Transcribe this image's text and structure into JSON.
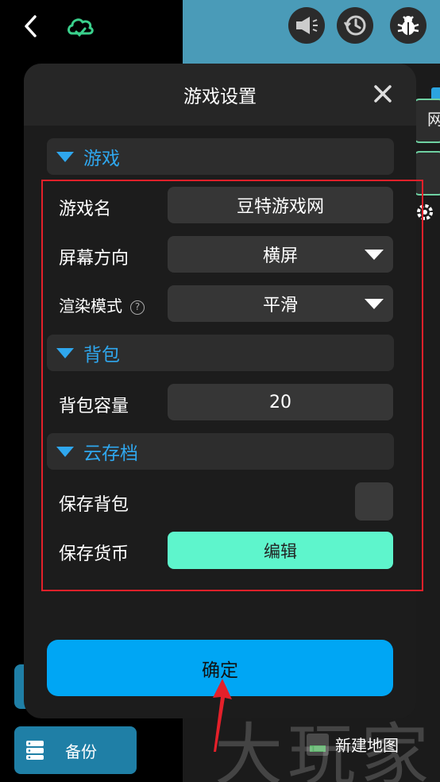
{
  "dialog": {
    "title": "游戏设置",
    "sections": {
      "game": "游戏",
      "backpack": "背包",
      "cloud": "云存档"
    },
    "rows": {
      "game_name": {
        "label": "游戏名",
        "value": "豆特游戏网"
      },
      "orientation": {
        "label": "屏幕方向",
        "value": "横屏"
      },
      "render_mode": {
        "label": "渲染模式",
        "value": "平滑"
      },
      "capacity": {
        "label": "背包容量",
        "value": "20"
      },
      "save_backpack": {
        "label": "保存背包",
        "checked": false
      },
      "save_currency": {
        "label": "保存货币",
        "button": "编辑"
      }
    },
    "confirm": "确定"
  },
  "background": {
    "backup_label": "备份",
    "new_map_label": "新建地图",
    "side_char": "网",
    "watermark": "大玩家"
  },
  "icons": {
    "back": "chevron-left-icon",
    "cloud": "cloud-icon",
    "announce": "megaphone-icon",
    "history": "history-icon",
    "debug": "bug-icon",
    "close": "close-icon",
    "help": "question-icon",
    "backup": "server-icon",
    "settings": "gear-icon"
  },
  "colors": {
    "accent_blue": "#00a6f4",
    "section_blue": "#2fa7ee",
    "mint": "#5ef5cc",
    "highlight_red": "#e4202a"
  }
}
